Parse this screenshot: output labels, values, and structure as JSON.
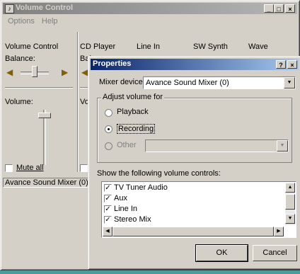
{
  "main_window": {
    "title": "Volume Control",
    "menu": [
      "Options",
      "Help"
    ],
    "controls": {
      "minimize": "_",
      "maximize": "□",
      "close": "×"
    },
    "master": {
      "name": "Volume Control",
      "balance_label": "Balance:",
      "volume_label": "Volume:",
      "mute_label": "Mute all",
      "mute_checked": false
    },
    "columns": [
      {
        "name": "CD Player",
        "balance_label": "Bal",
        "volume_label": "Vol"
      },
      {
        "name": "Line In"
      },
      {
        "name": "SW Synth"
      },
      {
        "name": "Wave"
      }
    ],
    "status": "Avance Sound Mixer (0)"
  },
  "dialog": {
    "title": "Properties",
    "help_button": "?",
    "close_button": "×",
    "mixer_device_label": "Mixer device:",
    "mixer_device_value": "Avance Sound Mixer (0)",
    "adjust_group_label": "Adjust volume for",
    "radios": [
      {
        "label": "Playback",
        "checked": false,
        "enabled": true
      },
      {
        "label": "Recording",
        "checked": true,
        "enabled": true
      },
      {
        "label": "Other",
        "checked": false,
        "enabled": false
      }
    ],
    "show_label": "Show the following volume controls:",
    "controls_list": [
      {
        "label": "TV Tuner Audio",
        "checked": true
      },
      {
        "label": "Aux",
        "checked": true
      },
      {
        "label": "Line In",
        "checked": true
      },
      {
        "label": "Stereo Mix",
        "checked": true
      }
    ],
    "ok_label": "OK",
    "cancel_label": "Cancel"
  }
}
